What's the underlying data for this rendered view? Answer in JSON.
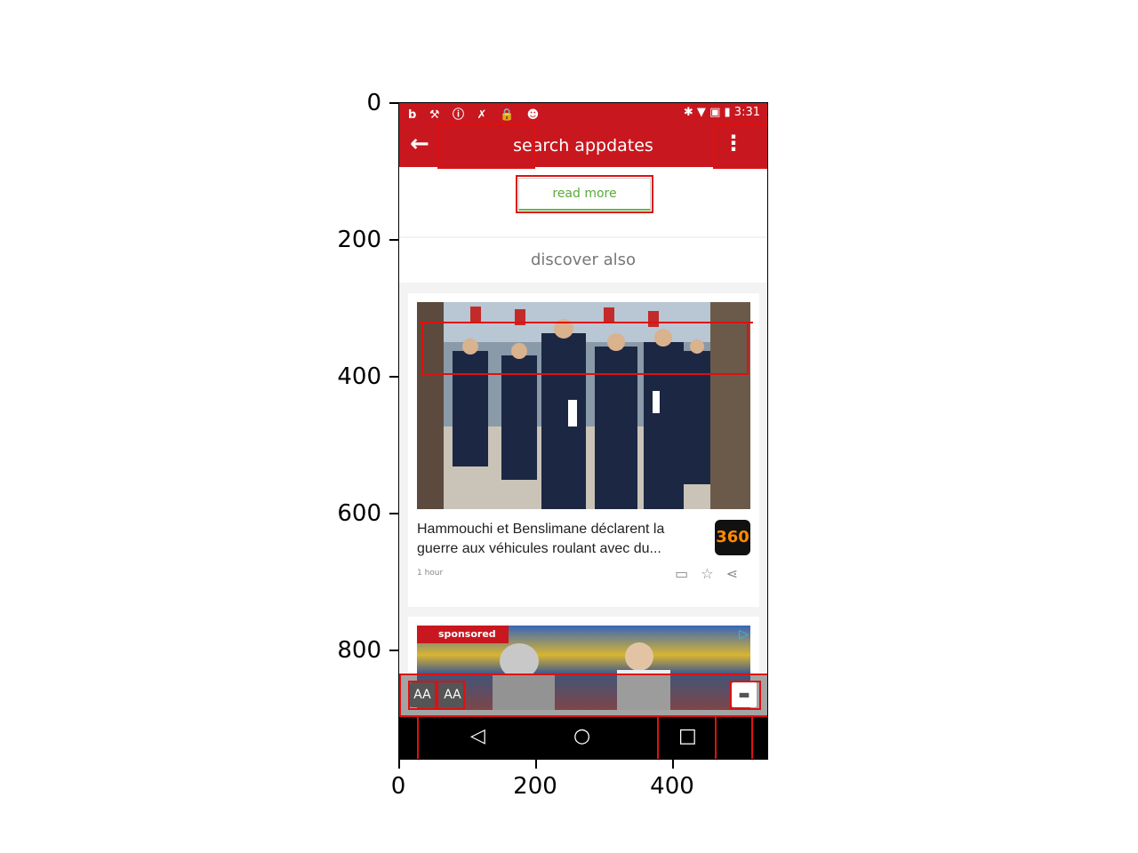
{
  "axes": {
    "y_ticks": [
      "0",
      "200",
      "400",
      "600",
      "800"
    ],
    "x_ticks": [
      "0",
      "200",
      "400"
    ]
  },
  "status_bar": {
    "left_icons": [
      "facebook-icon",
      "tools-icon",
      "alert-icon",
      "no-wrench-icon",
      "lock-icon",
      "android-icon"
    ],
    "right_icons": [
      "bluetooth-icon",
      "wifi-icon",
      "no-sim-icon",
      "battery-icon"
    ],
    "time": "3:31"
  },
  "app_bar": {
    "title": "search appdates",
    "back_icon": "arrow-left-icon",
    "menu_icon": "more-vert-icon"
  },
  "content": {
    "read_more": "read more",
    "discover_label": "discover also"
  },
  "article": {
    "title": "Hammouchi et Benslimane déclarent la guerre aux véhicules roulant avec du...",
    "source": "360",
    "time": "1 hour",
    "actions": [
      "comment-icon",
      "star-icon",
      "share-icon"
    ]
  },
  "ad": {
    "label": "sponsored",
    "adchoices_icon": "adchoices-icon"
  },
  "toolbar": {
    "text_smaller": "AA",
    "text_larger": "AA",
    "comment_icon": "comment-icon"
  },
  "nav": {
    "back": "◁",
    "home": "○",
    "recents": "□"
  },
  "colors": {
    "brand": "#c8171e",
    "read_more_green": "#5aaa3a",
    "annotation": "#dd1111"
  }
}
